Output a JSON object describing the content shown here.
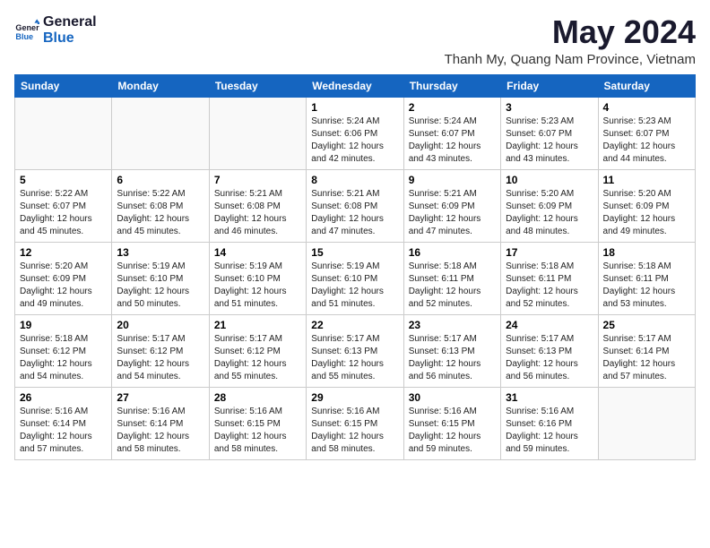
{
  "logo": {
    "general": "General",
    "blue": "Blue"
  },
  "title": "May 2024",
  "subtitle": "Thanh My, Quang Nam Province, Vietnam",
  "days_of_week": [
    "Sunday",
    "Monday",
    "Tuesday",
    "Wednesday",
    "Thursday",
    "Friday",
    "Saturday"
  ],
  "weeks": [
    [
      {
        "day": "",
        "info": ""
      },
      {
        "day": "",
        "info": ""
      },
      {
        "day": "",
        "info": ""
      },
      {
        "day": "1",
        "info": "Sunrise: 5:24 AM\nSunset: 6:06 PM\nDaylight: 12 hours\nand 42 minutes."
      },
      {
        "day": "2",
        "info": "Sunrise: 5:24 AM\nSunset: 6:07 PM\nDaylight: 12 hours\nand 43 minutes."
      },
      {
        "day": "3",
        "info": "Sunrise: 5:23 AM\nSunset: 6:07 PM\nDaylight: 12 hours\nand 43 minutes."
      },
      {
        "day": "4",
        "info": "Sunrise: 5:23 AM\nSunset: 6:07 PM\nDaylight: 12 hours\nand 44 minutes."
      }
    ],
    [
      {
        "day": "5",
        "info": "Sunrise: 5:22 AM\nSunset: 6:07 PM\nDaylight: 12 hours\nand 45 minutes."
      },
      {
        "day": "6",
        "info": "Sunrise: 5:22 AM\nSunset: 6:08 PM\nDaylight: 12 hours\nand 45 minutes."
      },
      {
        "day": "7",
        "info": "Sunrise: 5:21 AM\nSunset: 6:08 PM\nDaylight: 12 hours\nand 46 minutes."
      },
      {
        "day": "8",
        "info": "Sunrise: 5:21 AM\nSunset: 6:08 PM\nDaylight: 12 hours\nand 47 minutes."
      },
      {
        "day": "9",
        "info": "Sunrise: 5:21 AM\nSunset: 6:09 PM\nDaylight: 12 hours\nand 47 minutes."
      },
      {
        "day": "10",
        "info": "Sunrise: 5:20 AM\nSunset: 6:09 PM\nDaylight: 12 hours\nand 48 minutes."
      },
      {
        "day": "11",
        "info": "Sunrise: 5:20 AM\nSunset: 6:09 PM\nDaylight: 12 hours\nand 49 minutes."
      }
    ],
    [
      {
        "day": "12",
        "info": "Sunrise: 5:20 AM\nSunset: 6:09 PM\nDaylight: 12 hours\nand 49 minutes."
      },
      {
        "day": "13",
        "info": "Sunrise: 5:19 AM\nSunset: 6:10 PM\nDaylight: 12 hours\nand 50 minutes."
      },
      {
        "day": "14",
        "info": "Sunrise: 5:19 AM\nSunset: 6:10 PM\nDaylight: 12 hours\nand 51 minutes."
      },
      {
        "day": "15",
        "info": "Sunrise: 5:19 AM\nSunset: 6:10 PM\nDaylight: 12 hours\nand 51 minutes."
      },
      {
        "day": "16",
        "info": "Sunrise: 5:18 AM\nSunset: 6:11 PM\nDaylight: 12 hours\nand 52 minutes."
      },
      {
        "day": "17",
        "info": "Sunrise: 5:18 AM\nSunset: 6:11 PM\nDaylight: 12 hours\nand 52 minutes."
      },
      {
        "day": "18",
        "info": "Sunrise: 5:18 AM\nSunset: 6:11 PM\nDaylight: 12 hours\nand 53 minutes."
      }
    ],
    [
      {
        "day": "19",
        "info": "Sunrise: 5:18 AM\nSunset: 6:12 PM\nDaylight: 12 hours\nand 54 minutes."
      },
      {
        "day": "20",
        "info": "Sunrise: 5:17 AM\nSunset: 6:12 PM\nDaylight: 12 hours\nand 54 minutes."
      },
      {
        "day": "21",
        "info": "Sunrise: 5:17 AM\nSunset: 6:12 PM\nDaylight: 12 hours\nand 55 minutes."
      },
      {
        "day": "22",
        "info": "Sunrise: 5:17 AM\nSunset: 6:13 PM\nDaylight: 12 hours\nand 55 minutes."
      },
      {
        "day": "23",
        "info": "Sunrise: 5:17 AM\nSunset: 6:13 PM\nDaylight: 12 hours\nand 56 minutes."
      },
      {
        "day": "24",
        "info": "Sunrise: 5:17 AM\nSunset: 6:13 PM\nDaylight: 12 hours\nand 56 minutes."
      },
      {
        "day": "25",
        "info": "Sunrise: 5:17 AM\nSunset: 6:14 PM\nDaylight: 12 hours\nand 57 minutes."
      }
    ],
    [
      {
        "day": "26",
        "info": "Sunrise: 5:16 AM\nSunset: 6:14 PM\nDaylight: 12 hours\nand 57 minutes."
      },
      {
        "day": "27",
        "info": "Sunrise: 5:16 AM\nSunset: 6:14 PM\nDaylight: 12 hours\nand 58 minutes."
      },
      {
        "day": "28",
        "info": "Sunrise: 5:16 AM\nSunset: 6:15 PM\nDaylight: 12 hours\nand 58 minutes."
      },
      {
        "day": "29",
        "info": "Sunrise: 5:16 AM\nSunset: 6:15 PM\nDaylight: 12 hours\nand 58 minutes."
      },
      {
        "day": "30",
        "info": "Sunrise: 5:16 AM\nSunset: 6:15 PM\nDaylight: 12 hours\nand 59 minutes."
      },
      {
        "day": "31",
        "info": "Sunrise: 5:16 AM\nSunset: 6:16 PM\nDaylight: 12 hours\nand 59 minutes."
      },
      {
        "day": "",
        "info": ""
      }
    ]
  ]
}
